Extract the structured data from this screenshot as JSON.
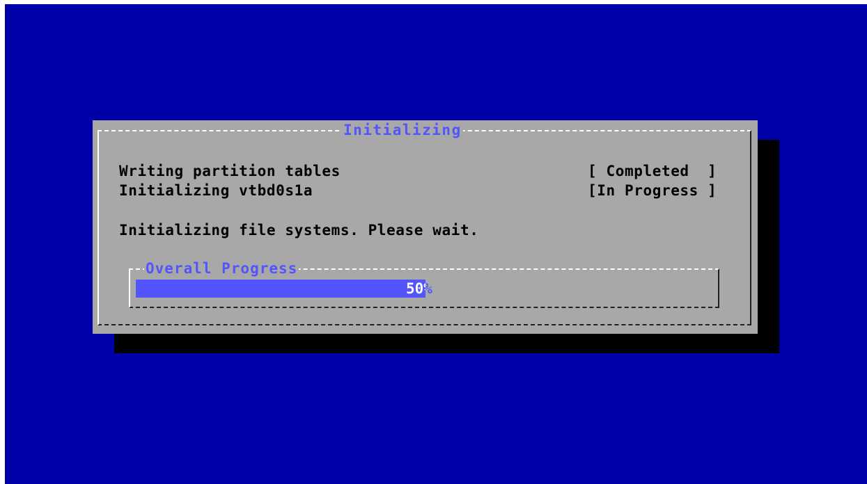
{
  "dialog": {
    "title": "Initializing",
    "tasks": [
      {
        "label": "Writing partition tables",
        "status": "[ Completed  ]"
      },
      {
        "label": "Initializing vtbd0s1a",
        "status": "[In Progress ]"
      }
    ],
    "message": "Initializing file systems. Please wait."
  },
  "progress": {
    "label": "Overall Progress",
    "percent_text": "50%",
    "value": 0.5
  },
  "colors": {
    "screen_background": "#0000a8",
    "dialog_background": "#a8a8a8",
    "title_color": "#5454fc",
    "progress_fill": "#5454fc",
    "shadow": "#000000"
  }
}
